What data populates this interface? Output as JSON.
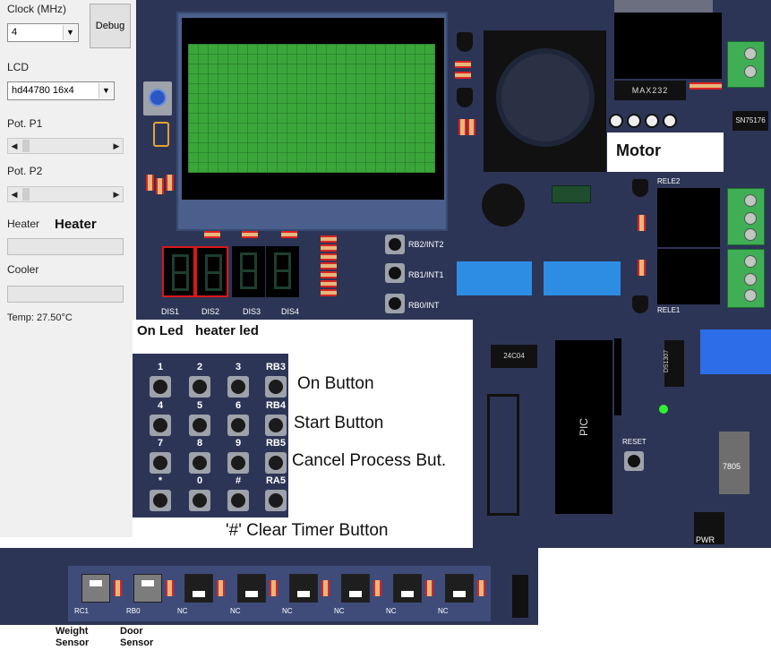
{
  "left_panel": {
    "clock_label": "Clock (MHz)",
    "clock_value": "4",
    "debug_button": "Debug",
    "lcd_label": "LCD",
    "lcd_value": "hd44780 16x4",
    "pot1_label": "Pot. P1",
    "pot2_label": "Pot. P2",
    "heater_label": "Heater",
    "heater_bold": "Heater",
    "cooler_label": "Cooler",
    "temp_text": "Temp: 27.50°C"
  },
  "overlay": {
    "motor": "Motor",
    "on_led": "On Led",
    "heater_led": "heater led",
    "on_button": "On Button",
    "start_button": "Start Button",
    "cancel_button": "Cancel Process But.",
    "clear_timer": "'#' Clear Timer Button"
  },
  "board": {
    "max_chip": "MAX232",
    "sn_chip": "SN75176",
    "rele2": "RELE2",
    "rele1": "RELE1",
    "pic": "PIC",
    "reset": "RESET",
    "eeprom": "24C04",
    "rtc": "DS1307",
    "regulator": "7805",
    "pwr": "PWR",
    "rb2": "RB2/INT2",
    "rb1": "RB1/INT1",
    "rb0": "RB0/INT",
    "displays": [
      "DIS1",
      "DIS2",
      "DIS3",
      "DIS4"
    ]
  },
  "keypad": {
    "labels": [
      "1",
      "2",
      "3",
      "RB3",
      "4",
      "5",
      "6",
      "RB4",
      "7",
      "8",
      "9",
      "RB5",
      "*",
      "0",
      "#",
      "RA5"
    ]
  },
  "bottom": {
    "switches": [
      "RC1",
      "RB0",
      "NC",
      "NC",
      "NC",
      "NC",
      "NC",
      "NC"
    ],
    "weight_sensor": "Weight Sensor",
    "door_sensor": "Door Sensor"
  },
  "colors": {
    "board": "#2d3556",
    "lcd": "#3aa63a",
    "seg_highlight": "#d81818",
    "dip_switch": "#2d8de3",
    "terminal": "#3fae55"
  }
}
